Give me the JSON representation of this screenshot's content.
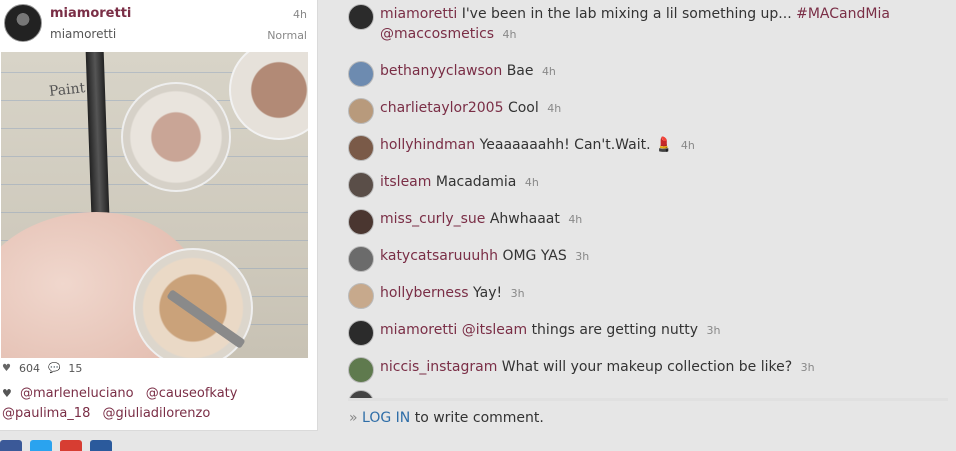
{
  "post": {
    "username": "miamoretti",
    "fullname": "miamoretti",
    "time": "4h",
    "filter": "Normal",
    "likes": "604",
    "comments_count": "15",
    "likers": [
      "@marleneluciano",
      "@causeofkaty",
      "@paulima_18",
      "@giuliadilorenzo"
    ],
    "photo_scribble": "Paint"
  },
  "comments": [
    {
      "user": "miamoretti",
      "text": "I've been in the lab mixing a lil something up...",
      "tag1": "#MACandMia",
      "tag2": "@maccosmetics",
      "time": "4h",
      "avatar_color": "#2b2b2b"
    },
    {
      "user": "bethanyyclawson",
      "text": "Bae",
      "time": "4h",
      "avatar_color": "#6d8bb0"
    },
    {
      "user": "charlietaylor2005",
      "text": "Cool",
      "time": "4h",
      "avatar_color": "#b89a7c"
    },
    {
      "user": "hollyhindman",
      "text": "Yeaaaaaahh! Can't.Wait.",
      "emoji": "💄",
      "time": "4h",
      "avatar_color": "#7a5a48"
    },
    {
      "user": "itsleam",
      "text": "Macadamia",
      "time": "4h",
      "avatar_color": "#5a4e48"
    },
    {
      "user": "miss_curly_sue",
      "text": "Ahwhaaat",
      "time": "4h",
      "avatar_color": "#4a3630"
    },
    {
      "user": "katycatsaruuuhh",
      "text": "OMG YAS",
      "time": "3h",
      "avatar_color": "#6b6b6b"
    },
    {
      "user": "hollyberness",
      "text": "Yay!",
      "time": "3h",
      "avatar_color": "#c7a98c"
    },
    {
      "user": "miamoretti",
      "mention": "@itsleam",
      "text": "things are getting nutty",
      "time": "3h",
      "avatar_color": "#2b2b2b"
    },
    {
      "user": "niccis_instagram",
      "text": "What will your makeup collection be like?",
      "time": "3h",
      "avatar_color": "#5f7a4e"
    }
  ],
  "login": {
    "arrow": "»",
    "link": "LOG IN",
    "rest": "to write comment."
  },
  "colors": {
    "username": "#7a2e46",
    "link": "#2f6ea8",
    "background": "#e6e6e6"
  },
  "social_icons": [
    "facebook-icon",
    "twitter-icon",
    "googleplus-icon",
    "share-icon"
  ]
}
